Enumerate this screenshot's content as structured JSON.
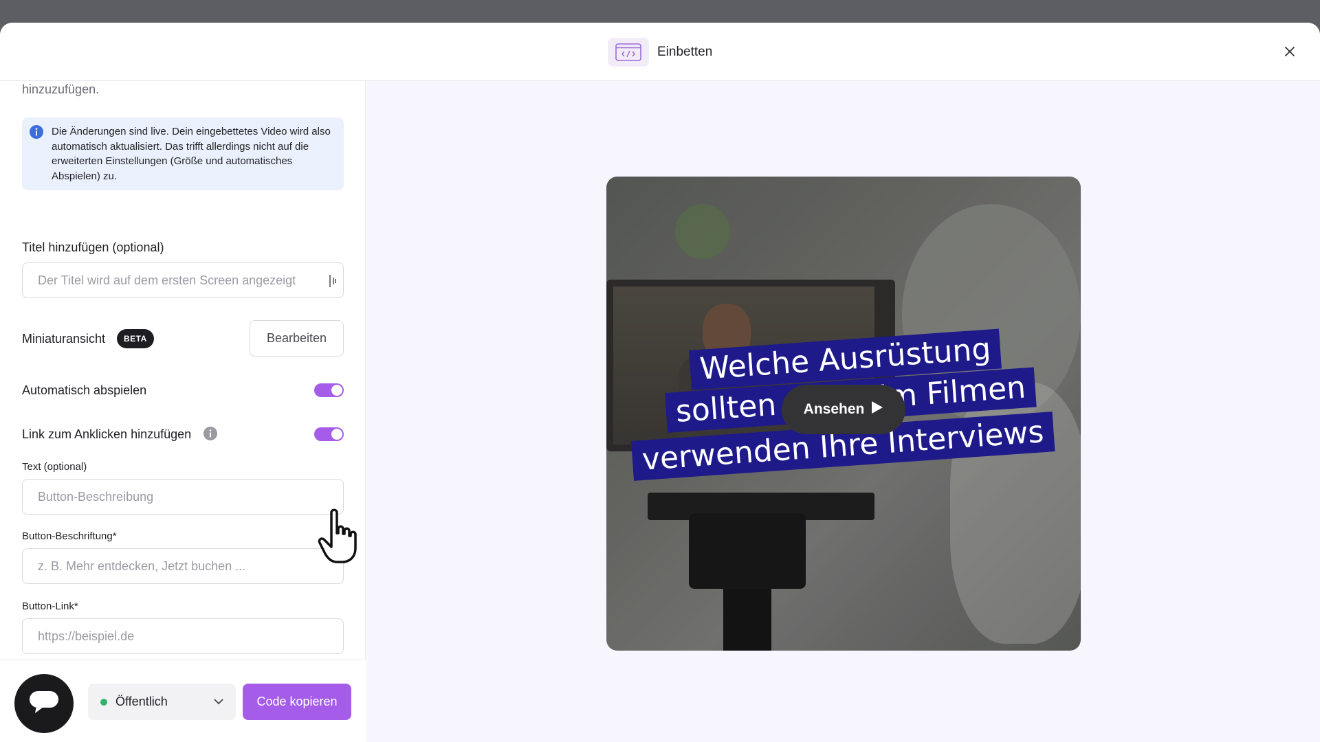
{
  "header": {
    "title": "Einbetten"
  },
  "left": {
    "cutoff_text": "hinzuzufügen.",
    "info_text": "Die Änderungen sind live. Dein eingebettetes Video wird also automatisch aktualisiert. Das trifft allerdings nicht auf die erweiterten Einstellungen (Größe und automatisches Abspielen) zu.",
    "title_label": "Titel hinzufügen (optional)",
    "title_placeholder": "Der Titel wird auf dem ersten Screen angezeigt",
    "thumbnail_label": "Miniaturansicht",
    "beta_badge": "BETA",
    "edit_button": "Bearbeiten",
    "autoplay_label": "Automatisch abspielen",
    "autoplay_on": true,
    "link_label": "Link zum Anklicken hinzufügen",
    "link_on": true,
    "text_label": "Text (optional)",
    "text_placeholder": "Button-Beschreibung",
    "button_caption_label": "Button-Beschriftung*",
    "button_caption_placeholder": "z. B. Mehr entdecken, Jetzt buchen ...",
    "button_link_label": "Button-Link*",
    "button_link_placeholder": "https://beispiel.de"
  },
  "footer": {
    "visibility_value": "Öffentlich",
    "copy_button": "Code kopieren"
  },
  "preview": {
    "banner_line1": "Welche Ausrüstung",
    "banner_line2": "sollten Sie beim Filmen",
    "banner_line3": "verwenden Ihre Interviews",
    "play_label": "Ansehen"
  },
  "colors": {
    "accent": "#a55de9",
    "status_green": "#2fb36a",
    "info_bg": "#eaf1fd",
    "preview_bg": "#f7f5fd",
    "banner": "#1e1a8a"
  },
  "icons": [
    "embed-code-icon",
    "close-icon",
    "info-icon",
    "text-cursor-icon",
    "chevron-down-icon",
    "chat-icon",
    "play-icon",
    "hand-pointer-cursor"
  ]
}
